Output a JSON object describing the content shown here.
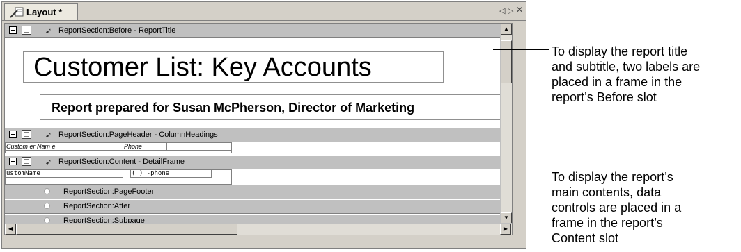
{
  "tab": {
    "label": "Layout *",
    "icon": "layout-icon"
  },
  "window_controls": {
    "prev": "◁",
    "next": "▷",
    "close": "✕"
  },
  "sections": {
    "before": "ReportSection:Before - ReportTitle",
    "page_header": "ReportSection:PageHeader - ColumnHeadings",
    "content": "ReportSection:Content - DetailFrame",
    "page_footer": "ReportSection:PageFooter",
    "after": "ReportSection:After",
    "subpage": "ReportSection:Subpage"
  },
  "report": {
    "title": "Customer List: Key Accounts",
    "subtitle": "Report prepared for Susan McPherson, Director of Marketing"
  },
  "column_headings": [
    "Custom er Nam e",
    "Phone",
    ""
  ],
  "detail_fields": [
    "ustomName",
    "( ) -phone"
  ],
  "annotations": [
    {
      "lines": [
        "To display the report title",
        "and subtitle, two labels are",
        "placed in a frame in the",
        "report’s Before slot"
      ]
    },
    {
      "lines": [
        "To display the report’s",
        "main contents, data",
        "controls are placed in a",
        "frame in the report’s",
        "Content slot"
      ]
    }
  ]
}
